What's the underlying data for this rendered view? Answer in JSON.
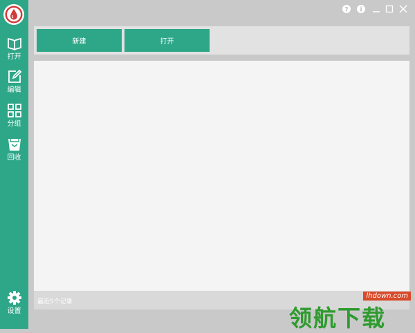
{
  "sidebar": {
    "items": [
      {
        "icon": "book-open-icon",
        "label": "打开"
      },
      {
        "icon": "edit-icon",
        "label": "编辑"
      },
      {
        "icon": "grid-icon",
        "label": "分组"
      },
      {
        "icon": "recycle-bin-icon",
        "label": "回收"
      }
    ],
    "settings": {
      "icon": "gear-icon",
      "label": "设置"
    }
  },
  "titlebar": {
    "buttons": [
      "help-icon",
      "info-icon",
      "minimize-icon",
      "maximize-icon",
      "close-icon"
    ]
  },
  "toolbar": {
    "new_label": "新建",
    "open_label": "打开"
  },
  "footer": {
    "recent_text": "最近5个记录"
  },
  "watermark": {
    "site": "lhdown.com",
    "text": "领航下载"
  },
  "colors": {
    "accent": "#2ea688",
    "background": "#c9c9c9",
    "content": "#f4f4f4",
    "logo_ring": "#d33a3a"
  }
}
